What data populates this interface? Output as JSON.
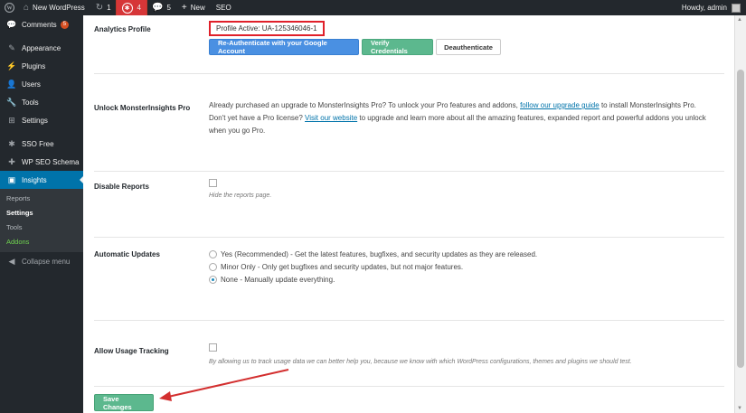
{
  "adminbar": {
    "site_name": "New WordPress",
    "updates_count": "1",
    "alerts_count": "4",
    "comments_count": "5",
    "new_label": "New",
    "seo_label": "SEO",
    "greeting": "Howdy, admin"
  },
  "sidebar": {
    "items": [
      {
        "label": "Comments",
        "icon": "comment-icon",
        "glyph": "💬",
        "badge": "5"
      },
      {
        "label": "Appearance",
        "icon": "paintbrush-icon",
        "glyph": "✎"
      },
      {
        "label": "Plugins",
        "icon": "plugin-icon",
        "glyph": "⚡"
      },
      {
        "label": "Users",
        "icon": "users-icon",
        "glyph": "👤"
      },
      {
        "label": "Tools",
        "icon": "wrench-icon",
        "glyph": "🔧"
      },
      {
        "label": "Settings",
        "icon": "settings-icon",
        "glyph": "⊞"
      },
      {
        "label": "SSO Free",
        "icon": "sso-icon",
        "glyph": "✱"
      },
      {
        "label": "WP SEO Schema",
        "icon": "schema-icon",
        "glyph": "✚"
      },
      {
        "label": "Insights",
        "icon": "insights-icon",
        "glyph": "▣"
      }
    ],
    "submenu": [
      "Reports",
      "Settings",
      "Tools",
      "Addons"
    ],
    "collapse_label": "Collapse menu"
  },
  "analytics": {
    "label": "Analytics Profile",
    "profile_text": "Profile Active: UA-125346046-1",
    "btn_reauth": "Re-Authenticate with your Google Account",
    "btn_verify": "Verify Credentials",
    "btn_deauth": "Deauthenticate"
  },
  "unlock": {
    "label": "Unlock MonsterInsights Pro",
    "line1_pre": "Already purchased an upgrade to MonsterInsights Pro? To unlock your Pro features and addons,",
    "line1_link": "follow our upgrade guide",
    "line1_post": "to install MonsterInsights Pro.",
    "line2_pre": "Don't yet have a Pro license?",
    "line2_link": "Visit our website",
    "line2_post": "to upgrade and learn more about all the amazing features, expanded report and powerful addons you unlock",
    "line3": "when you go Pro."
  },
  "disable_reports": {
    "label": "Disable Reports",
    "desc": "Hide the reports page."
  },
  "auto_updates": {
    "label": "Automatic Updates",
    "options": [
      "Yes (Recommended) - Get the latest features, bugfixes, and security updates as they are released.",
      "Minor Only - Only get bugfixes and security updates, but not major features.",
      "None - Manually update everything."
    ],
    "selected_index": 2
  },
  "usage_tracking": {
    "label": "Allow Usage Tracking",
    "desc": "By allowing us to track usage data we can better help you, because we know with which WordPress configurations, themes and plugins we should test."
  },
  "save_label": "Save Changes",
  "colors": {
    "admin_dark": "#23282d",
    "primary_blue": "#0073aa",
    "insights_green": "#5cb88e",
    "highlight_red": "#e0202a"
  }
}
